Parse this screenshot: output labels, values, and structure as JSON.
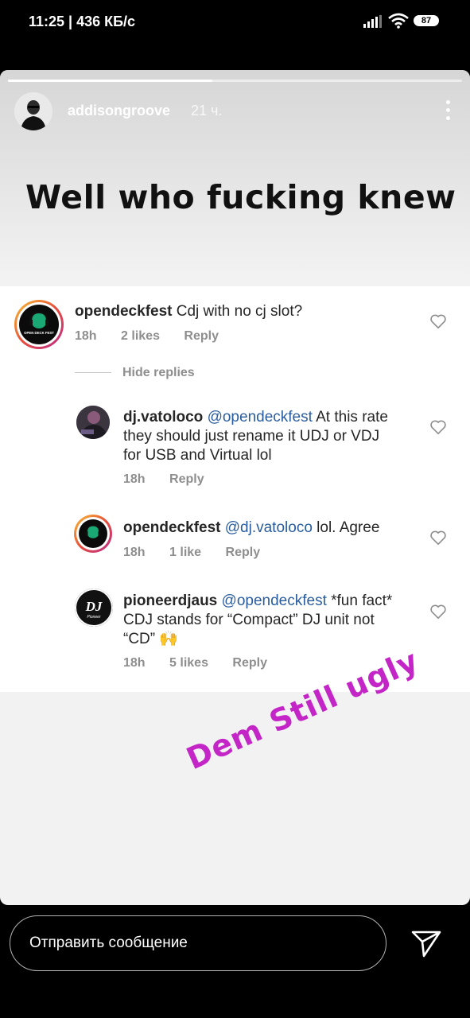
{
  "status_bar": {
    "time": "11:25 | 436 КБ/с",
    "battery": "87"
  },
  "story": {
    "username": "addisongroove",
    "time_ago": "21 ч.",
    "progress": 0.45,
    "headline": "Well who fucking knew",
    "scribble": "Dem Still ugly"
  },
  "comments": {
    "hide_replies": "Hide replies",
    "main": {
      "user": "opendeckfest",
      "text": "Cdj with no cj slot?",
      "time": "18h",
      "likes": "2 likes",
      "reply": "Reply",
      "avatar_text": "OPEN DECK FEST"
    },
    "replies": [
      {
        "user": "dj.vatoloco",
        "mention": "@opendeckfest",
        "text_line1": " At this rate",
        "text_line2": "they should just rename it UDJ or VDJ",
        "text_line3": "for USB and Virtual lol",
        "time": "18h",
        "likes": "",
        "reply": "Reply"
      },
      {
        "user": "opendeckfest",
        "mention": "@dj.vatoloco",
        "text_line1": " lol. Agree",
        "time": "18h",
        "likes": "1 like",
        "reply": "Reply"
      },
      {
        "user": "pioneerdjaus",
        "mention": "@opendeckfest",
        "text_line1": " *fun fact*",
        "text_line2": "CDJ stands for “Compact” DJ unit not",
        "text_line3": "“CD” 🙌",
        "time": "18h",
        "likes": "5 likes",
        "reply": "Reply",
        "avatar_text": "DJ",
        "avatar_sub": "Pioneer"
      }
    ]
  },
  "bottom": {
    "message_placeholder": "Отправить сообщение"
  },
  "colors": {
    "mention": "#2a5d9f",
    "scribble": "#c425c6",
    "meta": "#8e8e8e"
  }
}
